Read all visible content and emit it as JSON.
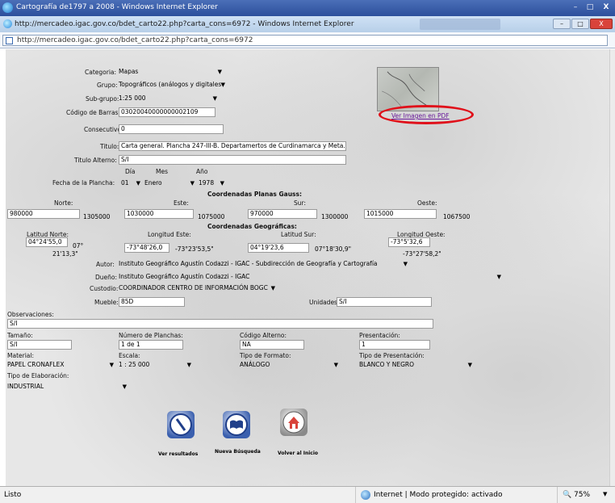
{
  "window": {
    "outer_title": "Cartografía de1797 a 2008 - Windows Internet Explorer",
    "inner_title": "http://mercadeo.igac.gov.co/bdet_carto22.php?carta_cons=6972 - Windows Internet Explorer",
    "address": "http://mercadeo.igac.gov.co/bdet_carto22.php?carta_cons=6972",
    "min": "–",
    "max": "□",
    "close": "X"
  },
  "form": {
    "categoria": {
      "label": "Categoria:",
      "value": "Mapas"
    },
    "grupo": {
      "label": "Grupo:",
      "value": "Topográficos (análogos y digitales"
    },
    "subgrupo": {
      "label": "Sub-grupo:",
      "value": "1:25 000"
    },
    "codigo_barras": {
      "label": "Código de Barras:",
      "value": "03020040000000002109"
    },
    "consecutivo": {
      "label": "Consecutivo:",
      "value": "0"
    },
    "titulo": {
      "label": "Titulo:",
      "value": "Carta general. Plancha 247-III-B. Departamertos de Curdinamarca y Meta. 1978"
    },
    "titulo_alterno": {
      "label": "Titulo Alterno:",
      "value": "S/I"
    },
    "fecha": {
      "label": "Fecha de la Plancha:",
      "dia_label": "Día",
      "mes_label": "Mes",
      "anio_label": "Año",
      "dia": "01",
      "mes": "Enero",
      "anio": "1978"
    },
    "gauss": {
      "title": "Coordenadas Planas Gauss:",
      "norte_label": "Norte:",
      "este_label": "Este:",
      "sur_label": "Sur:",
      "oeste_label": "Oeste:",
      "norte": "980000",
      "norte2": "1305000",
      "este": "1030000",
      "este2": "1075000",
      "sur": "970000",
      "sur2": "1300000",
      "oeste": "1015000",
      "oeste2": "1067500"
    },
    "geo": {
      "title": "Coordenadas Geográficas:",
      "lat_norte_label": "Latitud Norte:",
      "long_este_label": "Longitud Este:",
      "lat_sur_label": "Latitud Sur:",
      "long_oeste_label": "Longitud Oeste:",
      "lat_norte": "04°24'55,0",
      "lat_norte2": "07°",
      "lat_norte3": "21'13,3\"",
      "long_este": "-73°48'26,0",
      "long_este2": "-73°23'53,5\"",
      "lat_sur": "04°19'23,6",
      "lat_sur2": "07°18'30,9\"",
      "long_oeste": "-73°5'32,6",
      "long_oeste2": "-73°27'58,2\""
    },
    "autor": {
      "label": "Autor:",
      "value": "Instituto Geográfico Agustín Codazzi - IGAC - Subdirección de Geografía y Cartografía"
    },
    "dueno": {
      "label": "Dueño:",
      "value": "Instituto Geográfico Agustín Codazzi - IGAC"
    },
    "custodio": {
      "label": "Custodio:",
      "value": "COORDINADOR CENTRO DE INFORMACIÓN BOGC"
    },
    "mueble": {
      "label": "Mueble:",
      "value": "85D"
    },
    "unidades": {
      "label": "Unidades:",
      "value": "S/I"
    },
    "observaciones": {
      "label": "Observaciones:",
      "value": "S/I"
    },
    "tamano": {
      "label": "Tamaño:",
      "value": "S/I"
    },
    "num_planchas": {
      "label": "Número de Planchas:",
      "value": "1 de 1"
    },
    "codigo_alterno": {
      "label": "Código Alterno:",
      "value": "NA"
    },
    "presentacion": {
      "label": "Presentación:",
      "value": "1"
    },
    "material": {
      "label": "Material:",
      "value": "PAPEL CRONAFLEX"
    },
    "escala": {
      "label": "Escala:",
      "value": "1 : 25 000"
    },
    "tipo_formato": {
      "label": "Tipo de Formato:",
      "value": "ANÁLOGO"
    },
    "tipo_presentacion": {
      "label": "Tipo de Presentación:",
      "value": "BLANCO Y NEGRO"
    },
    "tipo_elaboracion": {
      "label": "Tipo de Elaboración:",
      "value": "INDUSTRIAL"
    }
  },
  "pdf_link": "Ver Imagen en PDF",
  "buttons": {
    "ver_resultados": "Ver resultados",
    "nueva_busqueda": "Nueva Búsqueda",
    "volver_inicio": "Volver al Inicio"
  },
  "status": {
    "left": "Listo",
    "zone": "Internet | Modo protegido: activado",
    "zoom": "75%"
  },
  "colors": {
    "highlight": "#e0101a",
    "link": "#6a1b9a"
  }
}
